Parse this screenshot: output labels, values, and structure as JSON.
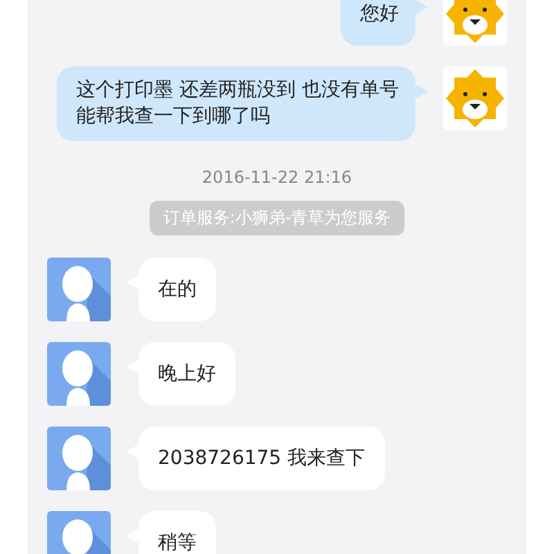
{
  "messages": [
    {
      "kind": "mine",
      "text": "您好"
    },
    {
      "kind": "mine",
      "text": "这个打印墨 还差两瓶没到 也没有单号能帮我查一下到哪了吗"
    },
    {
      "kind": "time",
      "text": "2016-11-22 21:16"
    },
    {
      "kind": "notice",
      "text": "订单服务:小狮弟-青草为您服务"
    },
    {
      "kind": "agent",
      "text": "在的"
    },
    {
      "kind": "agent",
      "text": "晚上好"
    },
    {
      "kind": "agent",
      "text": "2038726175  我来查下"
    },
    {
      "kind": "agent",
      "text": "稍等"
    }
  ]
}
